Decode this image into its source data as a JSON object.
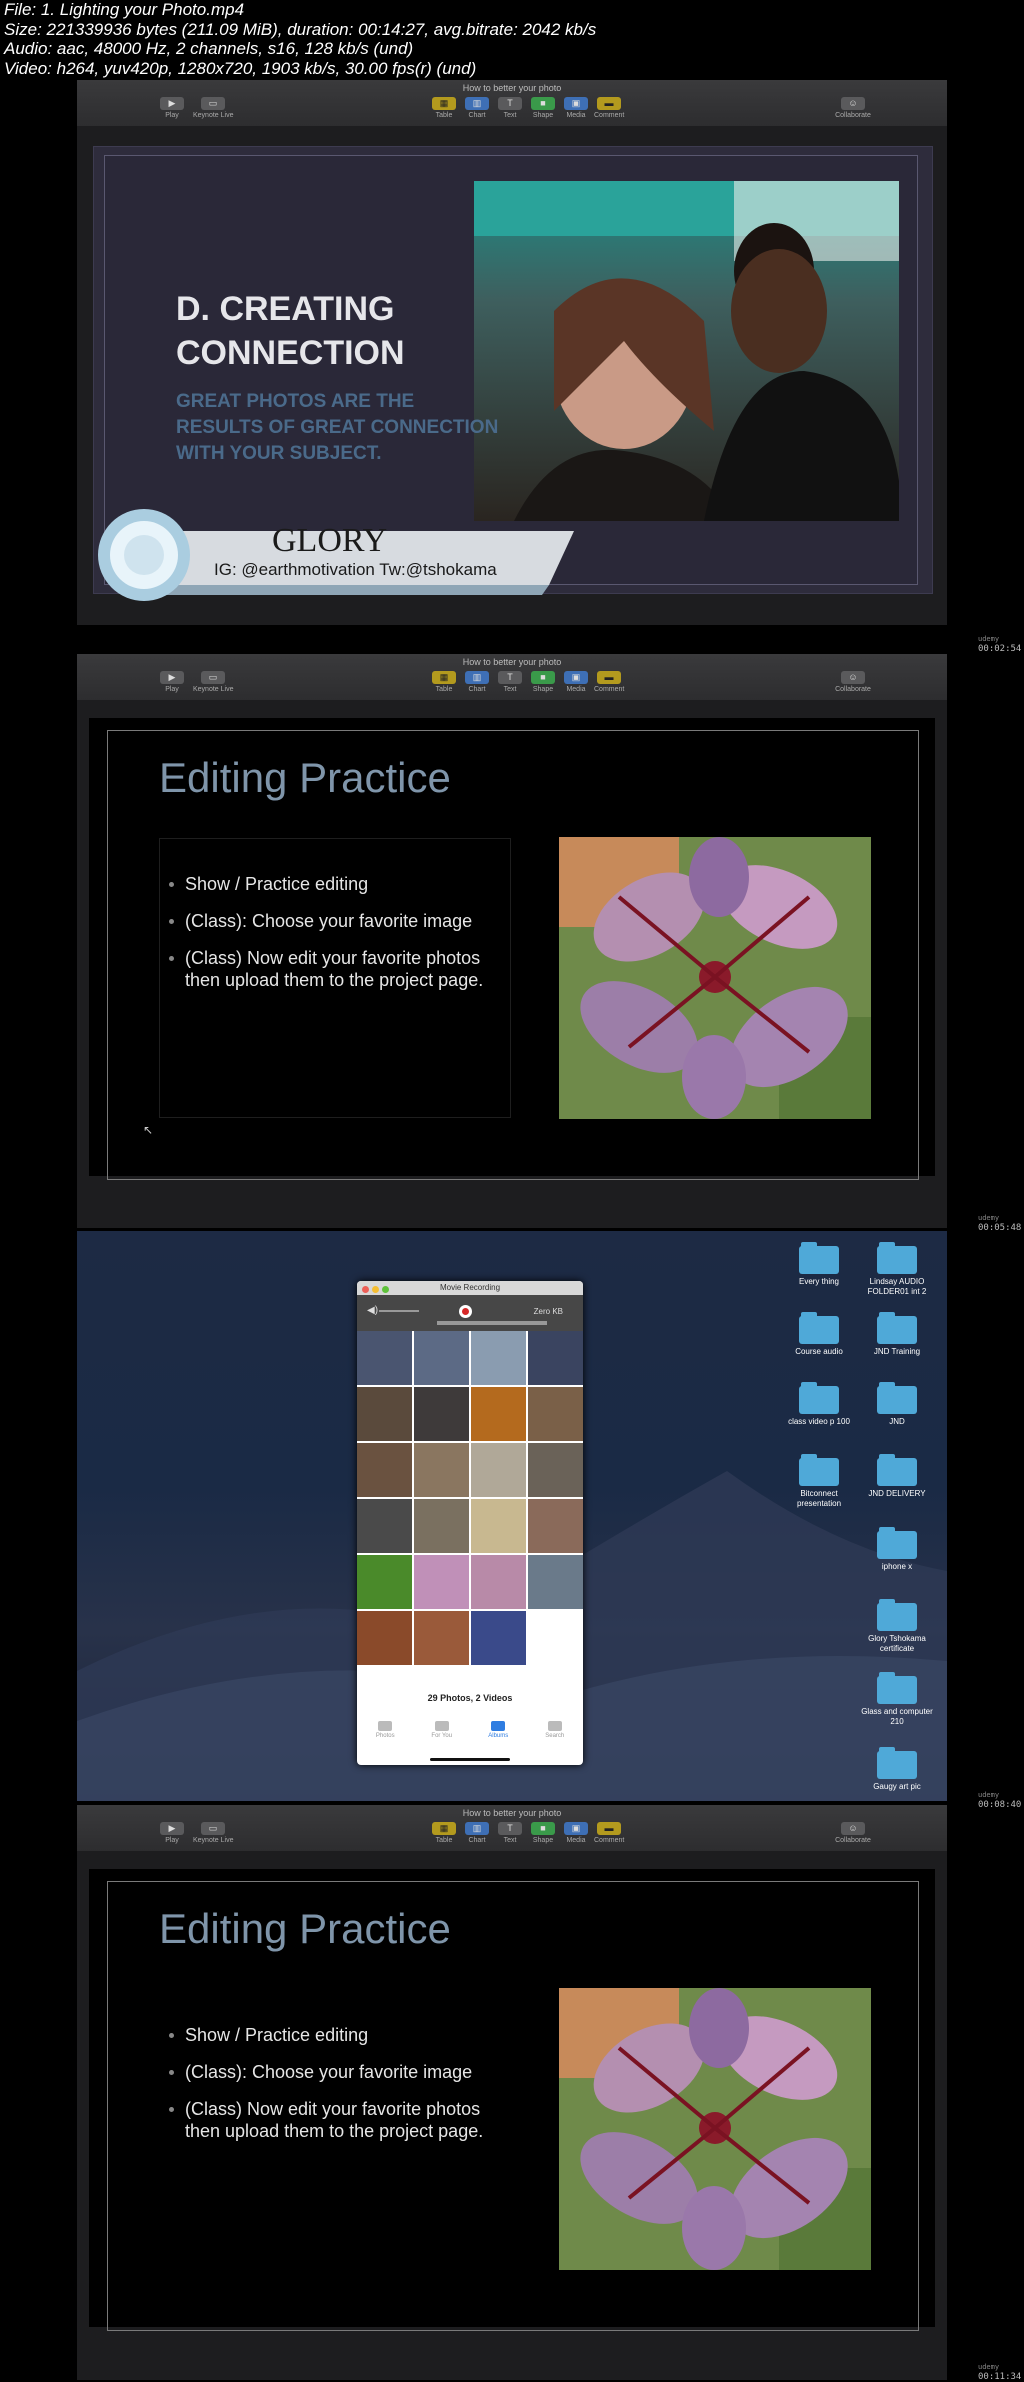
{
  "file_info": {
    "line1": "File: 1. Lighting your Photo.mp4",
    "line2": "Size: 221339936 bytes (211.09 MiB), duration: 00:14:27, avg.bitrate: 2042 kb/s",
    "line3": "Audio: aac, 48000 Hz, 2 channels, s16, 128 kb/s (und)",
    "line4": "Video: h264, yuv420p, 1280x720, 1903 kb/s, 30.00 fps(r) (und)"
  },
  "toolbar": {
    "doc_title": "How to better your photo",
    "play": "Play",
    "keynote_live": "Keynote Live",
    "table": "Table",
    "chart": "Chart",
    "text": "Text",
    "shape": "Shape",
    "media": "Media",
    "comment": "Comment",
    "collaborate": "Collaborate"
  },
  "timestamps": {
    "t1": "00:02:54",
    "t2": "00:05:48",
    "t3": "00:08:40",
    "t4": "00:11:34",
    "brand": "udemy"
  },
  "slide1": {
    "heading": "D. CREATING CONNECTION",
    "subheading": "GREAT PHOTOS ARE THE RESULTS OF GREAT CONNECTION WITH YOUR SUBJECT.",
    "name": "GLORY",
    "handles": "IG: @earthmotivation Tw:@tshokama"
  },
  "editing_slide": {
    "title": "Editing Practice",
    "bullets": [
      "Show / Practice editing",
      "(Class): Choose your favorite image",
      "(Class) Now edit your favorite photos then upload them to the project page."
    ]
  },
  "movie_recording": {
    "title": "Movie Recording",
    "zero_kb": "Zero KB",
    "count": "29 Photos, 2 Videos",
    "tabs": [
      "Photos",
      "For You",
      "Albums",
      "Search"
    ],
    "active_tab": "Albums"
  },
  "desktop_folders": [
    "Every thing",
    "Lindsay AUDIO FOLDER01 int 2",
    "Course audio",
    "JND Training",
    "class video p 100",
    "JND",
    "Bitconnect presentation",
    "JND DELIVERY",
    "iphone x",
    "Glory Tshokama certificate",
    "Glass and computer 210",
    "Gaugy art pic"
  ],
  "colors": {
    "title_blue": "#7f95aa",
    "subheading_blue": "#4a6a8a",
    "folder_blue": "#4fa9d8",
    "record_red": "#d62828"
  }
}
